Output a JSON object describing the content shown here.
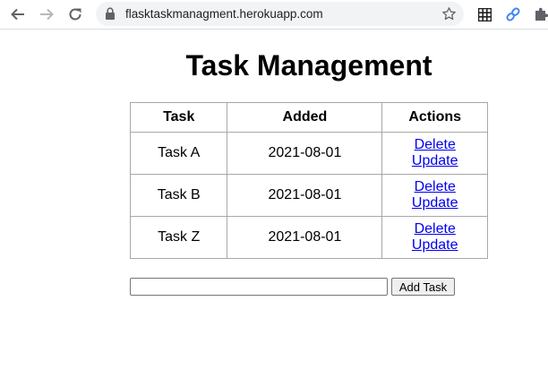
{
  "browser": {
    "url": "flasktaskmanagment.herokuapp.com"
  },
  "page": {
    "title": "Task Management"
  },
  "table": {
    "headers": [
      "Task",
      "Added",
      "Actions"
    ],
    "rows": [
      {
        "task": "Task A",
        "added": "2021-08-01",
        "delete_label": "Delete",
        "update_label": "Update"
      },
      {
        "task": "Task B",
        "added": "2021-08-01",
        "delete_label": "Delete",
        "update_label": "Update"
      },
      {
        "task": "Task Z",
        "added": "2021-08-01",
        "delete_label": "Delete",
        "update_label": "Update"
      }
    ]
  },
  "form": {
    "task_input_value": "",
    "add_button_label": "Add Task"
  },
  "colors": {
    "link": "#0000ee",
    "omnibox_bg": "#f1f3f4",
    "extension_link_icon": "#4285f4"
  }
}
